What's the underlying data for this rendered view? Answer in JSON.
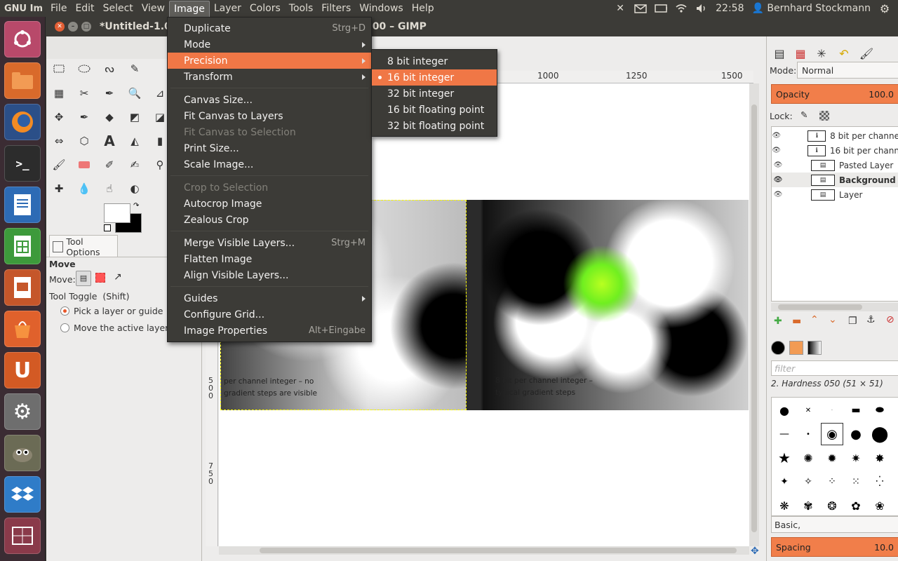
{
  "topbar": {
    "app_name": "GNU Im",
    "menus": [
      "File",
      "Edit",
      "Select",
      "View",
      "Image",
      "Layer",
      "Colors",
      "Tools",
      "Filters",
      "Windows",
      "Help"
    ],
    "clock": "22:58",
    "user": "Bernhard Stockmann"
  },
  "window": {
    "title_left": "*Untitled-1.0",
    "title_right": "500 – GIMP"
  },
  "image_menu": {
    "items": [
      {
        "label": "Duplicate",
        "accel": "Strg+D"
      },
      {
        "label": "Mode",
        "accel": ""
      },
      {
        "label": "Precision",
        "accel": ""
      },
      {
        "label": "Transform",
        "accel": ""
      },
      {
        "label": "Canvas Size...",
        "accel": ""
      },
      {
        "label": "Fit Canvas to Layers",
        "accel": ""
      },
      {
        "label": "Fit Canvas to Selection",
        "accel": ""
      },
      {
        "label": "Print Size...",
        "accel": ""
      },
      {
        "label": "Scale Image...",
        "accel": ""
      },
      {
        "label": "Crop to Selection",
        "accel": ""
      },
      {
        "label": "Autocrop Image",
        "accel": ""
      },
      {
        "label": "Zealous Crop",
        "accel": ""
      },
      {
        "label": "Merge Visible Layers...",
        "accel": "Strg+M"
      },
      {
        "label": "Flatten Image",
        "accel": ""
      },
      {
        "label": "Align Visible Layers...",
        "accel": ""
      },
      {
        "label": "Guides",
        "accel": ""
      },
      {
        "label": "Configure Grid...",
        "accel": ""
      },
      {
        "label": "Image Properties",
        "accel": "Alt+Eingabe"
      }
    ]
  },
  "precision_menu": {
    "items": [
      "8 bit integer",
      "16 bit integer",
      "32 bit integer",
      "16 bit floating point",
      "32 bit floating point"
    ],
    "selected": "16 bit integer"
  },
  "toolbox": {
    "tab_label": "Tool Options",
    "tool_name": "Move",
    "move_label": "Move:",
    "toggle_label": "Tool Toggle  (Shift)",
    "options": [
      "Pick a layer or guide",
      "Move the active layer"
    ],
    "selected_option": "Pick a layer or guide"
  },
  "rulers": {
    "h_ticks": [
      "1000",
      "1250",
      "1500"
    ],
    "v_ticks": [
      "500",
      "750"
    ]
  },
  "canvas": {
    "caption_left": [
      "per channel integer – no",
      "gradient steps are visible"
    ],
    "caption_right": [
      "8 bit per channel integer –",
      "typical gradient steps"
    ]
  },
  "layers_panel": {
    "mode_label": "Mode:",
    "mode_value": "Normal",
    "opacity_label": "Opacity",
    "opacity_value": "100.0",
    "lock_label": "Lock:",
    "layers": [
      {
        "name": "8 bit per channe",
        "active": false
      },
      {
        "name": "16 bit per chann",
        "active": false
      },
      {
        "name": "Pasted Layer",
        "active": false
      },
      {
        "name": "Background",
        "active": true
      },
      {
        "name": "Layer",
        "active": false
      }
    ]
  },
  "brushes_panel": {
    "filter_placeholder": "filter",
    "brush_name": "2. Hardness 050 (51 × 51)",
    "preset": "Basic,",
    "spacing_label": "Spacing",
    "spacing_value": "10.0"
  },
  "colors": {
    "accent": "#f07746",
    "menu_bg": "#3c3b37",
    "launcher_bg": "#3b2c33"
  }
}
